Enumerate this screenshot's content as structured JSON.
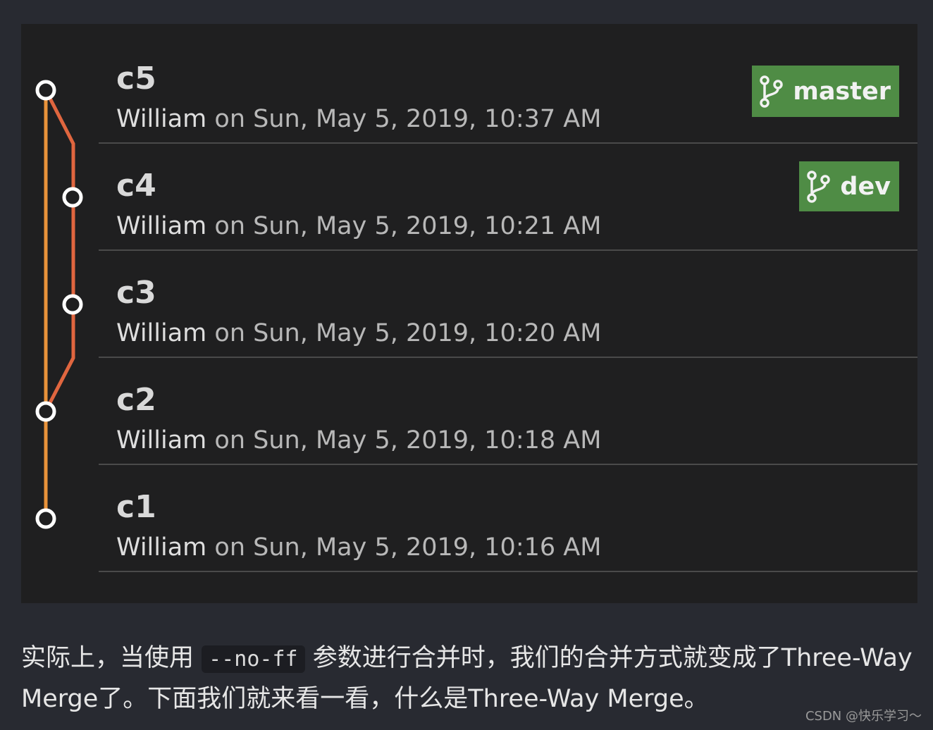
{
  "commits": [
    {
      "title": "c5",
      "author": "William",
      "on_text": " on Sun, May 5, 2019, 10:37 AM",
      "branch": "master"
    },
    {
      "title": "c4",
      "author": "William",
      "on_text": " on Sun, May 5, 2019, 10:21 AM",
      "branch": "dev"
    },
    {
      "title": "c3",
      "author": "William",
      "on_text": " on Sun, May 5, 2019, 10:20 AM",
      "branch": ""
    },
    {
      "title": "c2",
      "author": "William",
      "on_text": " on Sun, May 5, 2019, 10:18 AM",
      "branch": ""
    },
    {
      "title": "c1",
      "author": "William",
      "on_text": " on Sun, May 5, 2019, 10:16 AM",
      "branch": ""
    }
  ],
  "colors": {
    "main_branch_line": "#e8923a",
    "dev_branch_line": "#e0663f",
    "branch_badge": "#4f8c45",
    "node_fill": "#1f1f20",
    "node_stroke": "#ffffff"
  },
  "icons": {
    "branch_badge_icon": "git-branch-icon"
  },
  "caption": {
    "part1": "实际上，当使用 ",
    "code": "--no-ff",
    "part2": " 参数进行合并时，我们的合并方式就变成了Three-Way Merge了。下面我们就来看一看，什么是Three-Way Merge。"
  },
  "watermark": "CSDN @快乐学习～"
}
